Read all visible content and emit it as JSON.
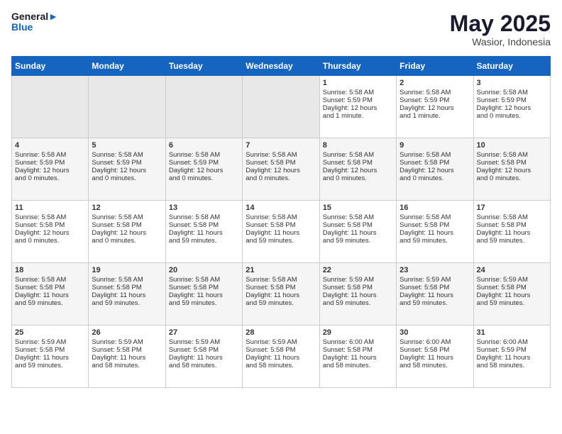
{
  "logo": {
    "line1": "General",
    "line2": "Blue"
  },
  "title": "May 2025",
  "location": "Wasior, Indonesia",
  "days_of_week": [
    "Sunday",
    "Monday",
    "Tuesday",
    "Wednesday",
    "Thursday",
    "Friday",
    "Saturday"
  ],
  "weeks": [
    [
      {
        "day": "",
        "empty": true
      },
      {
        "day": "",
        "empty": true
      },
      {
        "day": "",
        "empty": true
      },
      {
        "day": "",
        "empty": true
      },
      {
        "day": "1",
        "line1": "Sunrise: 5:58 AM",
        "line2": "Sunset: 5:59 PM",
        "line3": "Daylight: 12 hours",
        "line4": "and 1 minute."
      },
      {
        "day": "2",
        "line1": "Sunrise: 5:58 AM",
        "line2": "Sunset: 5:59 PM",
        "line3": "Daylight: 12 hours",
        "line4": "and 1 minute."
      },
      {
        "day": "3",
        "line1": "Sunrise: 5:58 AM",
        "line2": "Sunset: 5:59 PM",
        "line3": "Daylight: 12 hours",
        "line4": "and 0 minutes."
      }
    ],
    [
      {
        "day": "4",
        "line1": "Sunrise: 5:58 AM",
        "line2": "Sunset: 5:59 PM",
        "line3": "Daylight: 12 hours",
        "line4": "and 0 minutes."
      },
      {
        "day": "5",
        "line1": "Sunrise: 5:58 AM",
        "line2": "Sunset: 5:59 PM",
        "line3": "Daylight: 12 hours",
        "line4": "and 0 minutes."
      },
      {
        "day": "6",
        "line1": "Sunrise: 5:58 AM",
        "line2": "Sunset: 5:59 PM",
        "line3": "Daylight: 12 hours",
        "line4": "and 0 minutes."
      },
      {
        "day": "7",
        "line1": "Sunrise: 5:58 AM",
        "line2": "Sunset: 5:58 PM",
        "line3": "Daylight: 12 hours",
        "line4": "and 0 minutes."
      },
      {
        "day": "8",
        "line1": "Sunrise: 5:58 AM",
        "line2": "Sunset: 5:58 PM",
        "line3": "Daylight: 12 hours",
        "line4": "and 0 minutes."
      },
      {
        "day": "9",
        "line1": "Sunrise: 5:58 AM",
        "line2": "Sunset: 5:58 PM",
        "line3": "Daylight: 12 hours",
        "line4": "and 0 minutes."
      },
      {
        "day": "10",
        "line1": "Sunrise: 5:58 AM",
        "line2": "Sunset: 5:58 PM",
        "line3": "Daylight: 12 hours",
        "line4": "and 0 minutes."
      }
    ],
    [
      {
        "day": "11",
        "line1": "Sunrise: 5:58 AM",
        "line2": "Sunset: 5:58 PM",
        "line3": "Daylight: 12 hours",
        "line4": "and 0 minutes."
      },
      {
        "day": "12",
        "line1": "Sunrise: 5:58 AM",
        "line2": "Sunset: 5:58 PM",
        "line3": "Daylight: 12 hours",
        "line4": "and 0 minutes."
      },
      {
        "day": "13",
        "line1": "Sunrise: 5:58 AM",
        "line2": "Sunset: 5:58 PM",
        "line3": "Daylight: 11 hours",
        "line4": "and 59 minutes."
      },
      {
        "day": "14",
        "line1": "Sunrise: 5:58 AM",
        "line2": "Sunset: 5:58 PM",
        "line3": "Daylight: 11 hours",
        "line4": "and 59 minutes."
      },
      {
        "day": "15",
        "line1": "Sunrise: 5:58 AM",
        "line2": "Sunset: 5:58 PM",
        "line3": "Daylight: 11 hours",
        "line4": "and 59 minutes."
      },
      {
        "day": "16",
        "line1": "Sunrise: 5:58 AM",
        "line2": "Sunset: 5:58 PM",
        "line3": "Daylight: 11 hours",
        "line4": "and 59 minutes."
      },
      {
        "day": "17",
        "line1": "Sunrise: 5:58 AM",
        "line2": "Sunset: 5:58 PM",
        "line3": "Daylight: 11 hours",
        "line4": "and 59 minutes."
      }
    ],
    [
      {
        "day": "18",
        "line1": "Sunrise: 5:58 AM",
        "line2": "Sunset: 5:58 PM",
        "line3": "Daylight: 11 hours",
        "line4": "and 59 minutes."
      },
      {
        "day": "19",
        "line1": "Sunrise: 5:58 AM",
        "line2": "Sunset: 5:58 PM",
        "line3": "Daylight: 11 hours",
        "line4": "and 59 minutes."
      },
      {
        "day": "20",
        "line1": "Sunrise: 5:58 AM",
        "line2": "Sunset: 5:58 PM",
        "line3": "Daylight: 11 hours",
        "line4": "and 59 minutes."
      },
      {
        "day": "21",
        "line1": "Sunrise: 5:58 AM",
        "line2": "Sunset: 5:58 PM",
        "line3": "Daylight: 11 hours",
        "line4": "and 59 minutes."
      },
      {
        "day": "22",
        "line1": "Sunrise: 5:59 AM",
        "line2": "Sunset: 5:58 PM",
        "line3": "Daylight: 11 hours",
        "line4": "and 59 minutes."
      },
      {
        "day": "23",
        "line1": "Sunrise: 5:59 AM",
        "line2": "Sunset: 5:58 PM",
        "line3": "Daylight: 11 hours",
        "line4": "and 59 minutes."
      },
      {
        "day": "24",
        "line1": "Sunrise: 5:59 AM",
        "line2": "Sunset: 5:58 PM",
        "line3": "Daylight: 11 hours",
        "line4": "and 59 minutes."
      }
    ],
    [
      {
        "day": "25",
        "line1": "Sunrise: 5:59 AM",
        "line2": "Sunset: 5:58 PM",
        "line3": "Daylight: 11 hours",
        "line4": "and 59 minutes."
      },
      {
        "day": "26",
        "line1": "Sunrise: 5:59 AM",
        "line2": "Sunset: 5:58 PM",
        "line3": "Daylight: 11 hours",
        "line4": "and 58 minutes."
      },
      {
        "day": "27",
        "line1": "Sunrise: 5:59 AM",
        "line2": "Sunset: 5:58 PM",
        "line3": "Daylight: 11 hours",
        "line4": "and 58 minutes."
      },
      {
        "day": "28",
        "line1": "Sunrise: 5:59 AM",
        "line2": "Sunset: 5:58 PM",
        "line3": "Daylight: 11 hours",
        "line4": "and 58 minutes."
      },
      {
        "day": "29",
        "line1": "Sunrise: 6:00 AM",
        "line2": "Sunset: 5:58 PM",
        "line3": "Daylight: 11 hours",
        "line4": "and 58 minutes."
      },
      {
        "day": "30",
        "line1": "Sunrise: 6:00 AM",
        "line2": "Sunset: 5:58 PM",
        "line3": "Daylight: 11 hours",
        "line4": "and 58 minutes."
      },
      {
        "day": "31",
        "line1": "Sunrise: 6:00 AM",
        "line2": "Sunset: 5:59 PM",
        "line3": "Daylight: 11 hours",
        "line4": "and 58 minutes."
      }
    ]
  ]
}
